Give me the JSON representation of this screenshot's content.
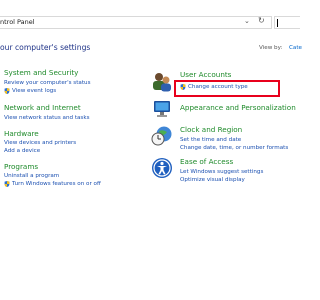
{
  "address_bar": {
    "path": "ntrol Panel",
    "chevron": "⌄",
    "refresh": "↻"
  },
  "header": {
    "heading": "our computer's settings",
    "view_by_label": "View by:",
    "view_by_value": "Cate"
  },
  "categories": {
    "system_security": {
      "title": "System and Security",
      "links": [
        "Review your computer's status",
        "View event logs"
      ]
    },
    "network_internet": {
      "title": "Network and Internet",
      "links": [
        "View network status and tasks"
      ]
    },
    "hardware": {
      "title": "Hardware",
      "links": [
        "View devices and printers",
        "Add a device"
      ]
    },
    "programs": {
      "title": "Programs",
      "links": [
        "Uninstall a program",
        "Turn Windows features on or off"
      ]
    },
    "user_accounts": {
      "title": "User Accounts",
      "links": [
        "Change account type"
      ]
    },
    "appearance": {
      "title": "Appearance and Personalization",
      "links": []
    },
    "clock_region": {
      "title": "Clock and Region",
      "links": [
        "Set the time and date",
        "Change date, time, or number formats"
      ]
    },
    "ease_access": {
      "title": "Ease of Access",
      "links": [
        "Let Windows suggest settings",
        "Optimize visual display"
      ]
    }
  },
  "colors": {
    "category_title": "#1e8a2a",
    "link": "#1a4fb0",
    "heading": "#1e3287",
    "highlight": "#e8001c"
  },
  "icons": {
    "uac_shield": "shield-icon",
    "user_accounts": "users-icon",
    "appearance": "appearance-icon",
    "clock_region": "clock-globe-icon",
    "ease_access": "ease-of-access-icon"
  }
}
